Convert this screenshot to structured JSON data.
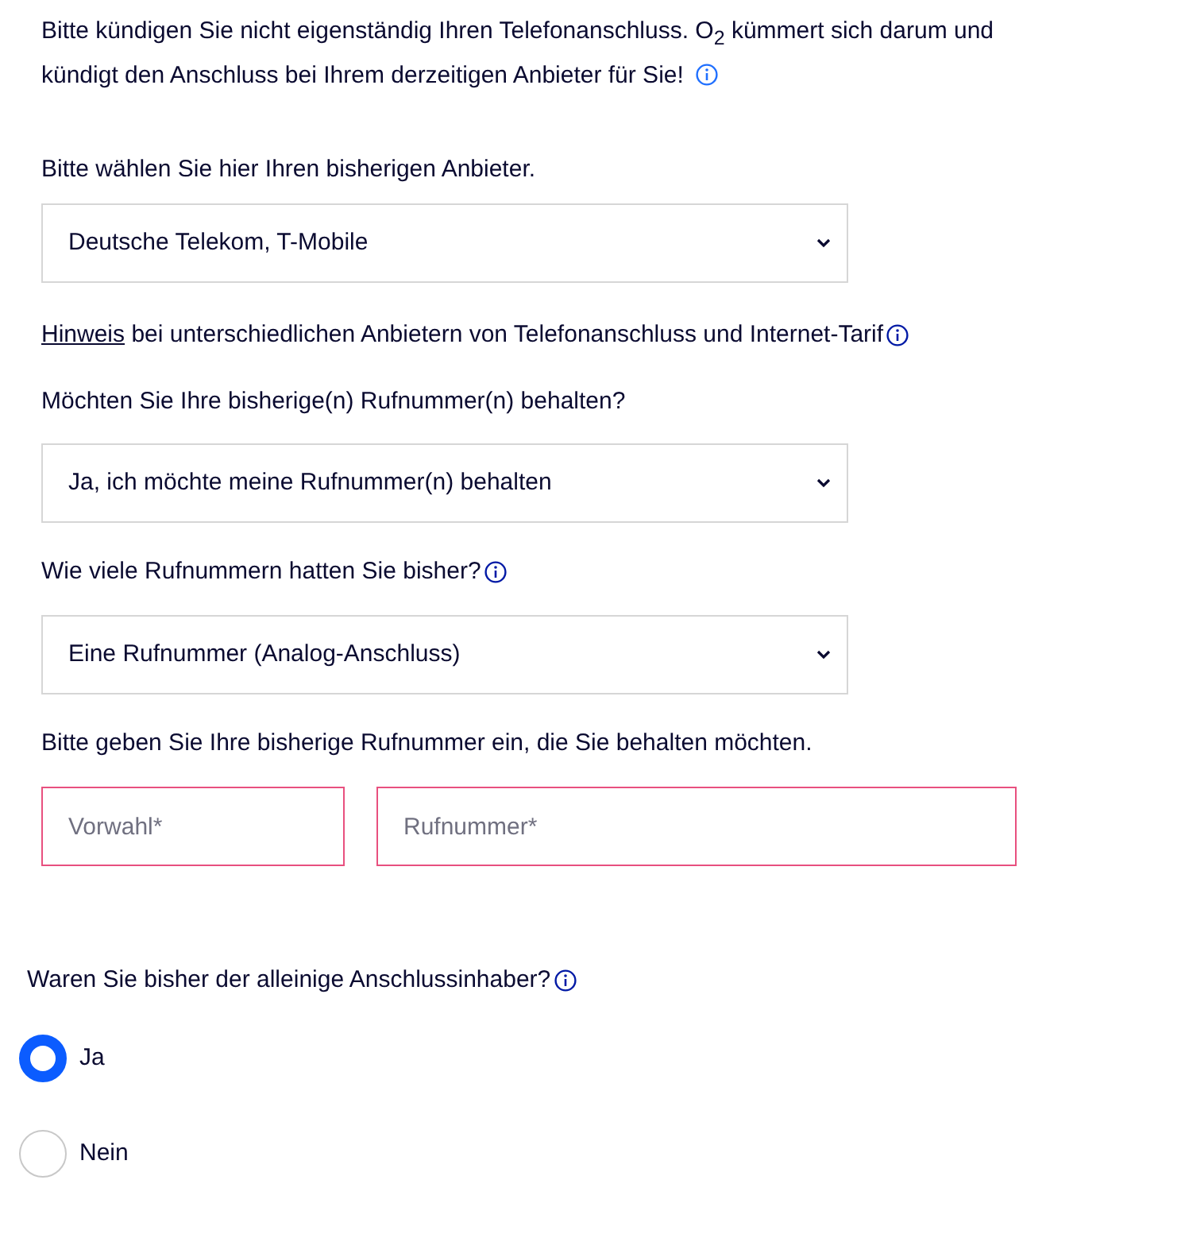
{
  "intro": {
    "text": "Bitte kündigen Sie nicht eigenständig Ihren Telefonanschluss. O$_{2}$ kümmert sich darum und kündigt den Anschluss bei Ihrem derzeitigen Anbieter für Sie!",
    "info": true
  },
  "provider": {
    "label": "Bitte wählen Sie hier Ihren bisherigen Anbieter.",
    "value": "Deutsche Telekom, T-Mobile"
  },
  "hint": {
    "link": "Hinweis",
    "text": "bei unterschiedlichen Anbietern von Telefonanschluss und Internet-Tarif",
    "info": true
  },
  "keep_number": {
    "label": "Möchten Sie Ihre bisherige(n) Rufnummer(n) behalten?",
    "value": "Ja, ich möchte meine Rufnummer(n) behalten"
  },
  "number_count": {
    "label": "Wie viele Rufnummern hatten Sie bisher?",
    "info": true,
    "value": "Eine Rufnummer (Analog-Anschluss)"
  },
  "number_entry": {
    "label": "Bitte geben Sie Ihre bisherige Rufnummer ein, die Sie behalten möchten.",
    "fields": [
      {
        "placeholder": "Vorwahl*",
        "invalid": true
      },
      {
        "placeholder": "Rufnummer*",
        "invalid": true
      }
    ]
  },
  "sole_owner": {
    "label": "Waren Sie bisher der alleinige Anschlussinhaber?",
    "info": true,
    "options": [
      {
        "label": "Ja",
        "selected": true
      },
      {
        "label": "Nein",
        "selected": false
      }
    ]
  }
}
